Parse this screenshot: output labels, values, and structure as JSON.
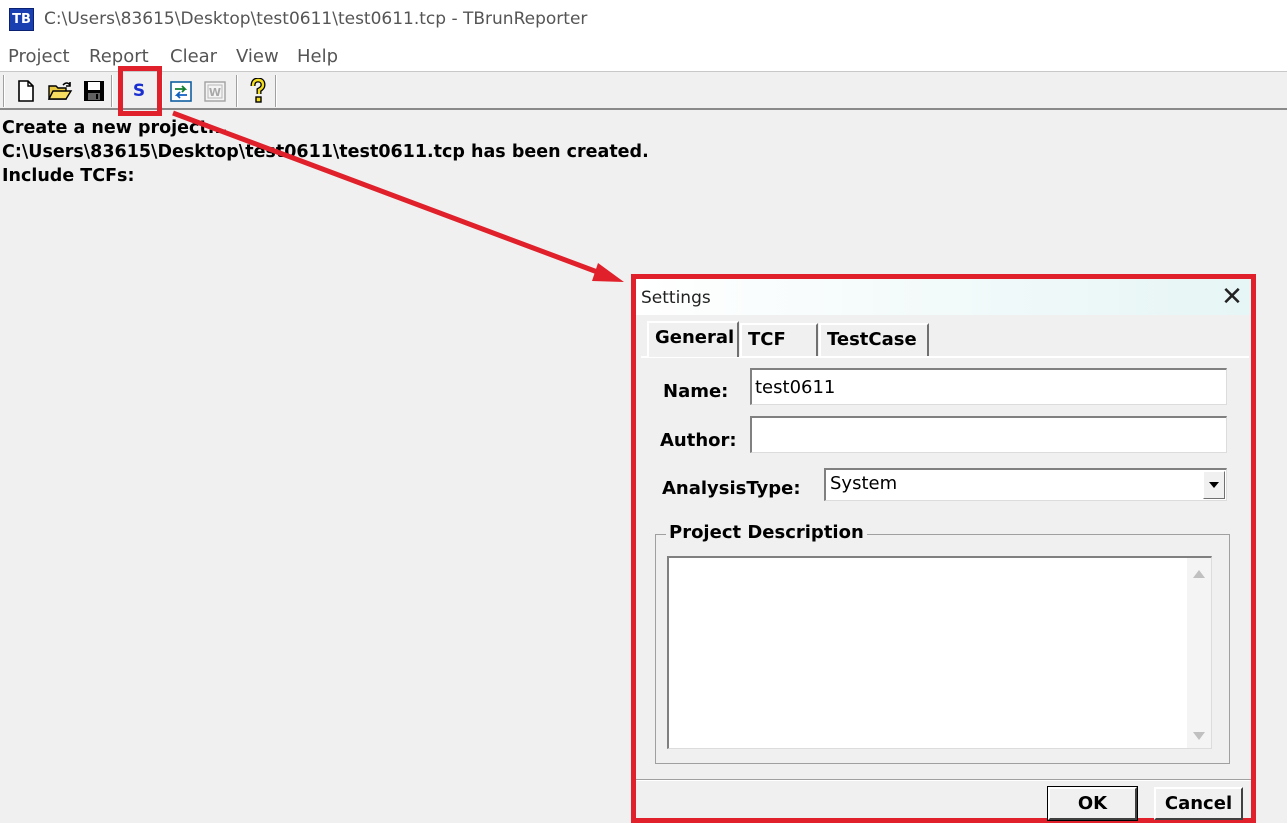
{
  "window": {
    "icon_text": "TB",
    "title": "C:\\Users\\83615\\Desktop\\test0611\\test0611.tcp - TBrunReporter"
  },
  "menu": [
    "Project",
    "Report",
    "Clear",
    "View",
    "Help"
  ],
  "toolbar": {
    "buttons": [
      {
        "icon": "new-file-icon"
      },
      {
        "icon": "open-folder-icon"
      },
      {
        "icon": "save-icon"
      },
      {
        "icon": "settings-s-icon",
        "label": "S"
      },
      {
        "icon": "convert-icon"
      },
      {
        "icon": "word-export-icon",
        "label": "W"
      },
      {
        "icon": "help-icon",
        "label": "?"
      }
    ]
  },
  "log": {
    "lines": [
      "Create a new project...",
      "C:\\Users\\83615\\Desktop\\test0611\\test0611.tcp has been created.",
      "Include TCFs:"
    ]
  },
  "annotation_color": "#e0202a",
  "dialog": {
    "title": "Settings",
    "close": "✕",
    "tabs": [
      "General",
      "TCF",
      "TestCase"
    ],
    "active_tab": "General",
    "name_label": "Name:",
    "name_value": "test0611",
    "author_label": "Author:",
    "author_value": "",
    "analysis_label": "AnalysisType:",
    "analysis_value": "System",
    "description_label": "Project Description",
    "description_value": "",
    "ok": "OK",
    "cancel": "Cancel"
  }
}
